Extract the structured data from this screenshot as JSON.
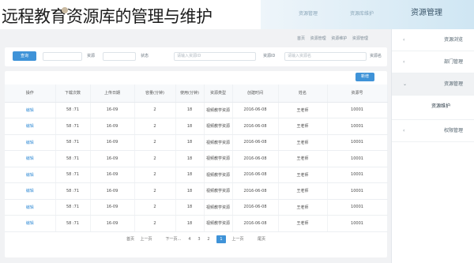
{
  "caption": "远程教育资源库的管理与维护",
  "header": {
    "tabs": [
      {
        "label": "资源管理"
      },
      {
        "label": "资源库维护"
      },
      {
        "label": "资源管理"
      }
    ]
  },
  "breadcrumb": [
    "首页",
    "资源管理",
    "资源维护",
    "资源管理"
  ],
  "filters": {
    "query_label": "查询",
    "fields": [
      {
        "label": "资源名",
        "placeholder": "请输入资源名"
      },
      {
        "label": "资源ID",
        "placeholder": "请输入资源ID"
      },
      {
        "label": "状态",
        "placeholder": ""
      },
      {
        "label": "资源",
        "placeholder": ""
      }
    ]
  },
  "toolbar": {
    "add_label": "新增"
  },
  "table": {
    "columns": [
      "资源号",
      "姓名",
      "创建时间",
      "资源类型",
      "使用(分钟)",
      "容量(分钟)",
      "上传日期",
      "下载次数",
      "操作"
    ],
    "rows": [
      [
        "10001",
        "王老师",
        "2016-06-08",
        "视频教学资源",
        "18",
        "2",
        "16-09",
        "58 :71",
        "编辑"
      ],
      [
        "10001",
        "王老师",
        "2016-06-08",
        "视频教学资源",
        "18",
        "2",
        "16-09",
        "58 :71",
        "编辑"
      ],
      [
        "10001",
        "王老师",
        "2016-06-08",
        "视频教学资源",
        "18",
        "2",
        "16-09",
        "58 :71",
        "编辑"
      ],
      [
        "10001",
        "王老师",
        "2016-06-08",
        "视频教学资源",
        "18",
        "2",
        "16-09",
        "58 :71",
        "编辑"
      ],
      [
        "10001",
        "王老师",
        "2016-06-08",
        "视频教学资源",
        "18",
        "2",
        "16-09",
        "58 :71",
        "编辑"
      ],
      [
        "10001",
        "王老师",
        "2016-06-08",
        "视频教学资源",
        "18",
        "2",
        "16-09",
        "58 :71",
        "编辑"
      ],
      [
        "10001",
        "王老师",
        "2016-06-08",
        "视频教学资源",
        "18",
        "2",
        "16-09",
        "58 :71",
        "编辑"
      ],
      [
        "10001",
        "王老师",
        "2016-06-08",
        "视频教学资源",
        "18",
        "2",
        "16-09",
        "58 :71",
        "编辑"
      ]
    ]
  },
  "pagination": {
    "first": "首页",
    "prev": "上一页",
    "pages": [
      "1",
      "2",
      "3",
      "4"
    ],
    "ellipsis": "...",
    "next": "下一页",
    "last": "尾页",
    "current": "1"
  },
  "sidebar": {
    "items": [
      {
        "label": "资源浏览"
      },
      {
        "label": "部门管理"
      },
      {
        "label": "资源管理"
      },
      {
        "label": "资源维护"
      },
      {
        "label": "权限管理"
      }
    ]
  },
  "colors": {
    "accent": "#3f93d8"
  }
}
